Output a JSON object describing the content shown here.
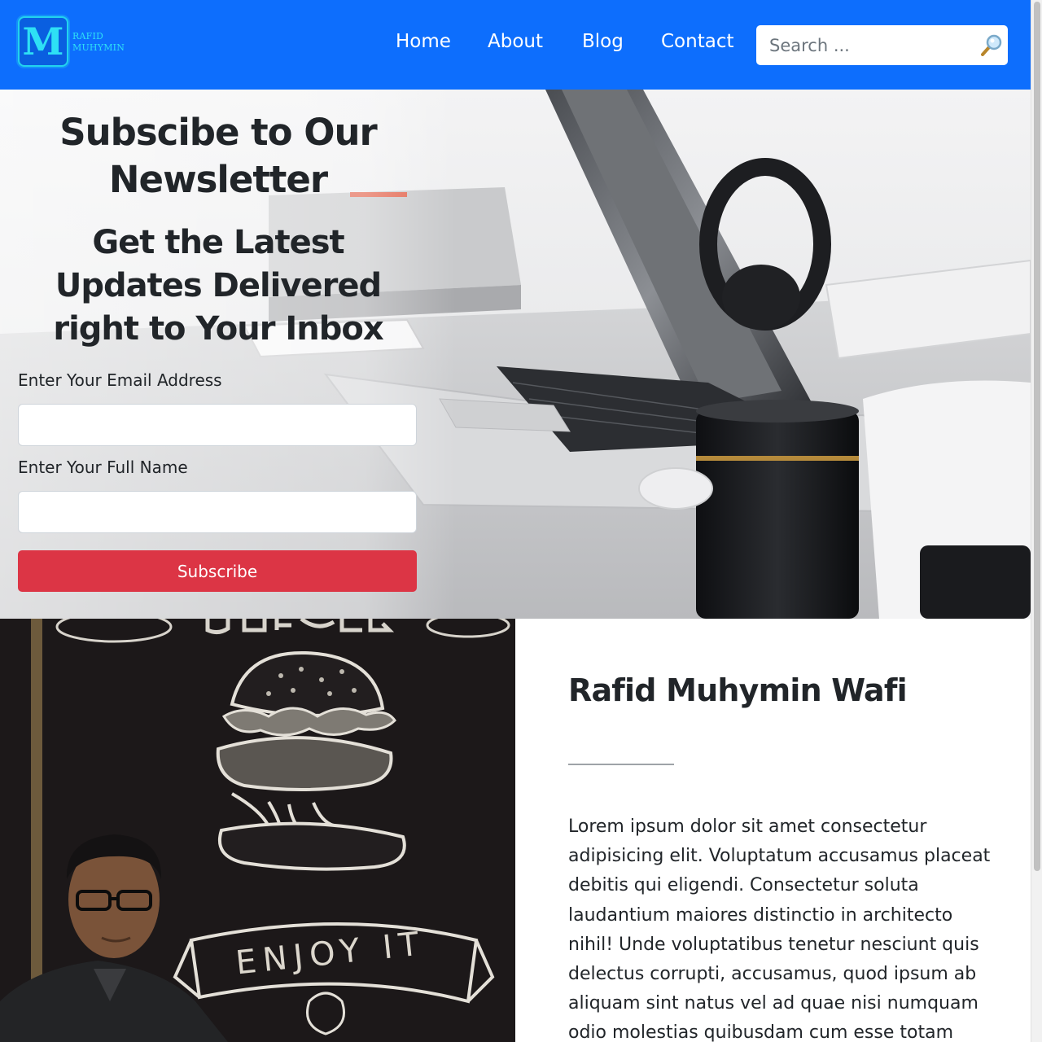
{
  "brand": {
    "logo_letter": "M",
    "name_line1": "RAFID",
    "name_line2": "MUHYMIN",
    "logo_color": "#2ee0f5"
  },
  "nav": {
    "background": "#0d6efd",
    "links": [
      {
        "label": "Home"
      },
      {
        "label": "About"
      },
      {
        "label": "Blog"
      },
      {
        "label": "Contact"
      }
    ],
    "search": {
      "placeholder": "Search ...",
      "value": "",
      "icon": "magnifier-icon"
    }
  },
  "hero": {
    "title": "Subscibe to Our Newsletter",
    "subtitle": "Get the Latest Updates Delivered right to Your Inbox",
    "form": {
      "email_label": "Enter Your Email Address",
      "email_value": "",
      "name_label": "Enter Your Full Name",
      "name_value": "",
      "submit_label": "Subscribe",
      "submit_color": "#dc3545"
    }
  },
  "about": {
    "photo_caption_text": "ENJOY IT",
    "photo_sign_text": "BURGER",
    "name": "Rafid Muhymin Wafi",
    "bio": "Lorem ipsum dolor sit amet consectetur adipisicing elit. Voluptatum accusamus placeat debitis qui eligendi. Consectetur soluta laudantium maiores distinctio in architecto nihil! Unde voluptatibus tenetur nesciunt quis delectus corrupti, accusamus, quod ipsum ab aliquam sint natus vel ad quae nisi numquam odio molestias quibusdam cum esse totam"
  }
}
